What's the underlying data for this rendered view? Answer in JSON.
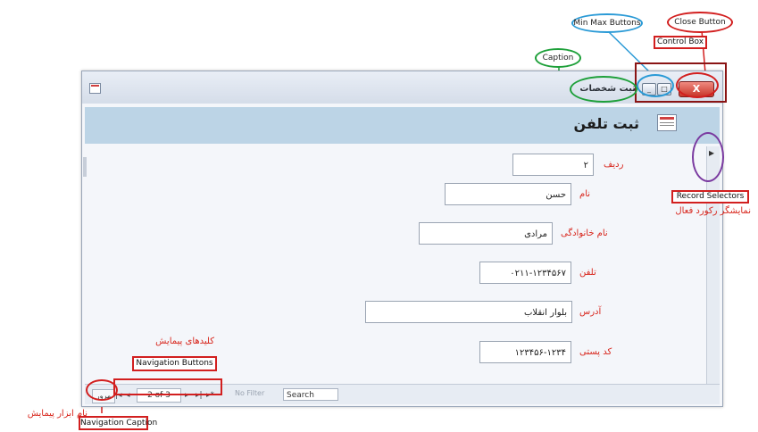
{
  "window": {
    "caption": "ثبت شخصات",
    "min_glyph": "_",
    "max_glyph": "□",
    "close_glyph": "X"
  },
  "form": {
    "title": "ثبت تلفن",
    "record_selector_glyph": "▸"
  },
  "fields": [
    {
      "label": "ردیف",
      "value": "۲"
    },
    {
      "label": "نام",
      "value": "حسن"
    },
    {
      "label": "نام خانوادگی",
      "value": "مرادی"
    },
    {
      "label": "تلفن",
      "value": "۰۲۱۱-۱۲۳۴۵۶۷"
    },
    {
      "label": "آدرس",
      "value": "بلوار انقلاب"
    },
    {
      "label": "کد پستی",
      "value": "۱۲۳۴۵۶-۱۲۳۴"
    }
  ],
  "nav": {
    "caption": "مرور",
    "first": "|◂",
    "prev": "◂",
    "record": "2 of 3",
    "next": "▸",
    "last": "▸|",
    "new": "▸*",
    "filter": "No Filter",
    "search": "Search"
  },
  "annotations": {
    "close_button": "Close Button",
    "min_max_buttons": "Min Max Buttons",
    "control_box": "Control Box",
    "caption": "Caption",
    "record_selectors": "Record Selectors",
    "record_selectors_fa": "نمایشگر رکورد فعال",
    "navigation_buttons": "Navigation Buttons",
    "navigation_buttons_fa": "کلیدهای پیمایش",
    "navigation_caption": "Navigation Caption",
    "navigation_caption_fa": "نام ابزار پیمایش"
  },
  "colors": {
    "annotation_red": "#d21f1f",
    "annotation_blue": "#2a9ad6",
    "annotation_green": "#1ea03a",
    "annotation_purple": "#7a3aa0",
    "header_band": "#bcd4e6"
  }
}
